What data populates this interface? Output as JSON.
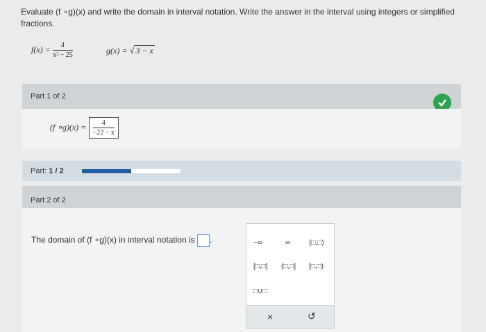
{
  "instructions": "Evaluate (f ∘g)(x) and write the domain in interval notation. Write the answer in the interval using integers or simplified fractions.",
  "functions": {
    "f_label": "f(x) =",
    "f_num": "4",
    "f_den": "x² − 25",
    "g_label": "g(x) =",
    "g_radicand": "3 − x"
  },
  "part1": {
    "header": "Part 1 of 2",
    "expr_label": "(f ∘g)(x) =",
    "answer_num": "4",
    "answer_den": "−22 − x",
    "status": "correct"
  },
  "progress": {
    "label": "Part:",
    "value": "1 / 2",
    "fraction": 0.5
  },
  "part2": {
    "header": "Part 2 of 2",
    "question": "The domain of (f ∘g)(x) in interval notation is",
    "input_value": ""
  },
  "palette": {
    "neg_infinity": "−∞",
    "infinity": "∞",
    "open_open": "(□,□)",
    "closed_closed": "[□,□]",
    "open_closed": "(□,□]",
    "closed_open": "[□,□)",
    "union": "□∪□",
    "clear": "×",
    "undo": "↺"
  },
  "colors": {
    "accent_blue": "#1f5fa3",
    "check_green": "#2ea44f"
  }
}
